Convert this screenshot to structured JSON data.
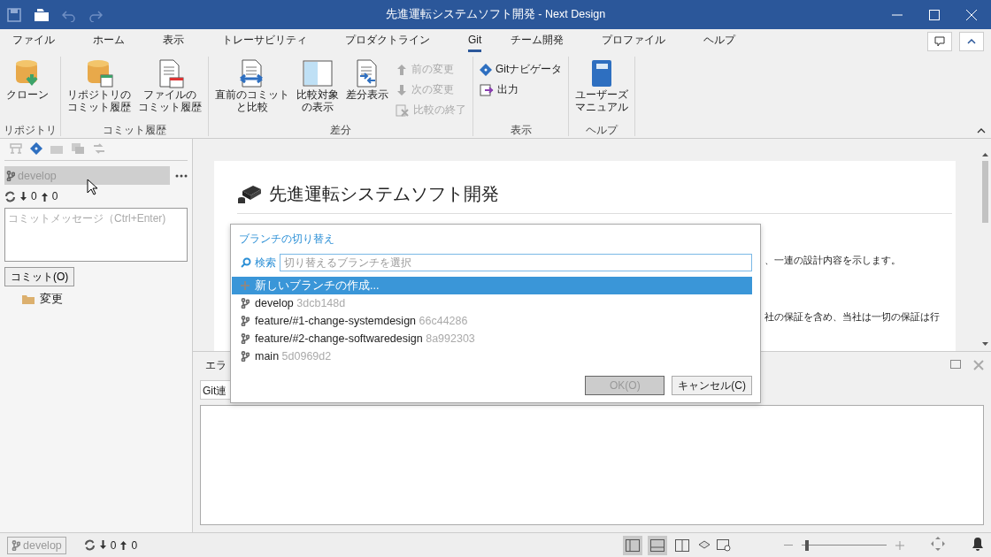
{
  "window": {
    "title": "先進運転システムソフト開発 - Next Design"
  },
  "menu_tabs": [
    {
      "label": "ファイル",
      "selected": false
    },
    {
      "label": "ホーム",
      "selected": false
    },
    {
      "label": "表示",
      "selected": false
    },
    {
      "label": "トレーサビリティ",
      "selected": false
    },
    {
      "label": "プロダクトライン",
      "selected": false
    },
    {
      "label": "Git",
      "selected": true
    },
    {
      "label": "チーム開発",
      "selected": false
    },
    {
      "label": "プロファイル",
      "selected": false
    },
    {
      "label": "ヘルプ",
      "selected": false
    }
  ],
  "ribbon": [
    {
      "label": "リポジトリ",
      "buttons": [
        {
          "kind": "large",
          "label": "クローン",
          "disabled": false
        }
      ]
    },
    {
      "label": "コミット履歴",
      "buttons": [
        {
          "kind": "large",
          "label_lines": [
            "リポジトリの",
            "コミット履歴"
          ],
          "disabled": false
        },
        {
          "kind": "large",
          "label_lines": [
            "ファイルの",
            "コミット履歴"
          ],
          "disabled": false
        }
      ]
    },
    {
      "label": "差分",
      "buttons": [
        {
          "kind": "large",
          "label_lines": [
            "直前のコミット",
            "と比較"
          ],
          "disabled": false
        },
        {
          "kind": "large",
          "label_lines": [
            "比較対象",
            "の表示"
          ],
          "disabled": false
        },
        {
          "kind": "large",
          "label": "差分表示",
          "disabled": false
        },
        {
          "kind": "small",
          "label": "前の変更",
          "disabled": true
        },
        {
          "kind": "small",
          "label": "次の変更",
          "disabled": true
        },
        {
          "kind": "small",
          "label": "比較の終了",
          "disabled": true
        }
      ]
    },
    {
      "label": "表示",
      "buttons": [
        {
          "kind": "small",
          "label": "Gitナビゲータ",
          "disabled": false
        },
        {
          "kind": "small",
          "label": "出力",
          "disabled": false
        }
      ]
    },
    {
      "label": "ヘルプ",
      "buttons": [
        {
          "kind": "large",
          "label_lines": [
            "ユーザーズ",
            "マニュアル"
          ],
          "disabled": false
        }
      ]
    }
  ],
  "git_panel": {
    "branch": "develop",
    "incoming": "0",
    "outgoing": "0",
    "commit_message": {
      "placeholder": "コミットメッセージ（Ctrl+Enter)"
    },
    "commit_button": "コミット(O)",
    "tree": [
      {
        "label": "変更"
      }
    ]
  },
  "document": {
    "title": "先進運転システムソフト開発",
    "fragments": [
      "、一連の設計内容を示します。",
      "社の保証を含め、当社は一切の保証は行"
    ]
  },
  "bottom_panel": {
    "tab": "エラ",
    "selector": "Git連"
  },
  "branch_dialog": {
    "title": "ブランチの切り替え",
    "search_label": "検索",
    "search": {
      "placeholder": "切り替えるブランチを選択"
    },
    "items": [
      {
        "kind": "create",
        "label": "新しいブランチの作成...",
        "selected": true
      },
      {
        "kind": "branch",
        "label": "develop",
        "hash": "3dcb148d",
        "selected": false
      },
      {
        "kind": "branch",
        "label": "feature/#1-change-systemdesign",
        "hash": "66c44286",
        "selected": false
      },
      {
        "kind": "branch",
        "label": "feature/#2-change-softwaredesign",
        "hash": "8a992303",
        "selected": false
      },
      {
        "kind": "branch",
        "label": "main",
        "hash": "5d0969d2",
        "selected": false
      }
    ],
    "ok_button": {
      "label": "OK(O)",
      "disabled": true
    },
    "cancel_button": {
      "label": "キャンセル(C)",
      "disabled": false
    }
  },
  "status_bar": {
    "branch": "develop",
    "incoming": "0",
    "outgoing": "0",
    "layouts": [
      {
        "selected": true
      },
      {
        "selected": true
      },
      {
        "selected": false
      }
    ],
    "zoom": {
      "level": 0.05
    }
  }
}
